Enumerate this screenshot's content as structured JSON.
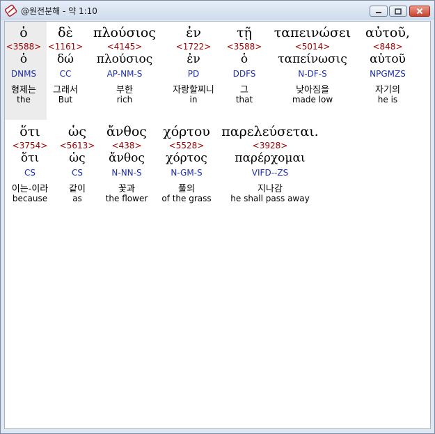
{
  "window": {
    "title": "@원전분해 - 약 1:10"
  },
  "colors": {
    "strong": "#a10000",
    "morph": "#1c2fb0",
    "highlight": "#ececec"
  },
  "words": [
    {
      "greek": "ὁ",
      "strong": "<3588>",
      "lemma": "ὁ",
      "morph": "DNMS",
      "korean": "형제는",
      "english": "the"
    },
    {
      "greek": "δὲ",
      "strong": "<1161>",
      "lemma": "δώ",
      "morph": "CC",
      "korean": "그래서",
      "english": "But"
    },
    {
      "greek": "πλούσιος",
      "strong": "<4145>",
      "lemma": "πλούσιος",
      "morph": "AP-NM-S",
      "korean": "부한",
      "english": "rich"
    },
    {
      "greek": "ἐν",
      "strong": "<1722>",
      "lemma": "ἐν",
      "morph": "PD",
      "korean": "자랑할찌니",
      "english": "in"
    },
    {
      "greek": "τῇ",
      "strong": "<3588>",
      "lemma": "ὁ",
      "morph": "DDFS",
      "korean": "그",
      "english": "that"
    },
    {
      "greek": "ταπεινώσει",
      "strong": "<5014>",
      "lemma": "ταπείνωσις",
      "morph": "N-DF-S",
      "korean": "낮아짐을",
      "english": "made low"
    },
    {
      "greek": "αὐτοῦ,",
      "strong": "<848>",
      "lemma": "αὑτοῦ",
      "morph": "NPGMZS",
      "korean": "자기의",
      "english": "he is"
    },
    {
      "greek": "ὅτι",
      "strong": "<3754>",
      "lemma": "ὅτι",
      "morph": "CS",
      "korean": "이는-이라",
      "english": "because"
    },
    {
      "greek": "ὡς",
      "strong": "<5613>",
      "lemma": "ὡς",
      "morph": "CS",
      "korean": "같이",
      "english": "as"
    },
    {
      "greek": "ἄνθος",
      "strong": "<438>",
      "lemma": "ἄνθος",
      "morph": "N-NN-S",
      "korean": "꽃과",
      "english": "the flower"
    },
    {
      "greek": "χόρτου",
      "strong": "<5528>",
      "lemma": "χόρτος",
      "morph": "N-GM-S",
      "korean": "풀의",
      "english": "of the grass"
    },
    {
      "greek": "παρελεύσεται.",
      "strong": "<3928>",
      "lemma": "παρέρχομαι",
      "morph": "VIFD--ZS",
      "korean": "지나감",
      "english": "he shall pass away"
    }
  ]
}
